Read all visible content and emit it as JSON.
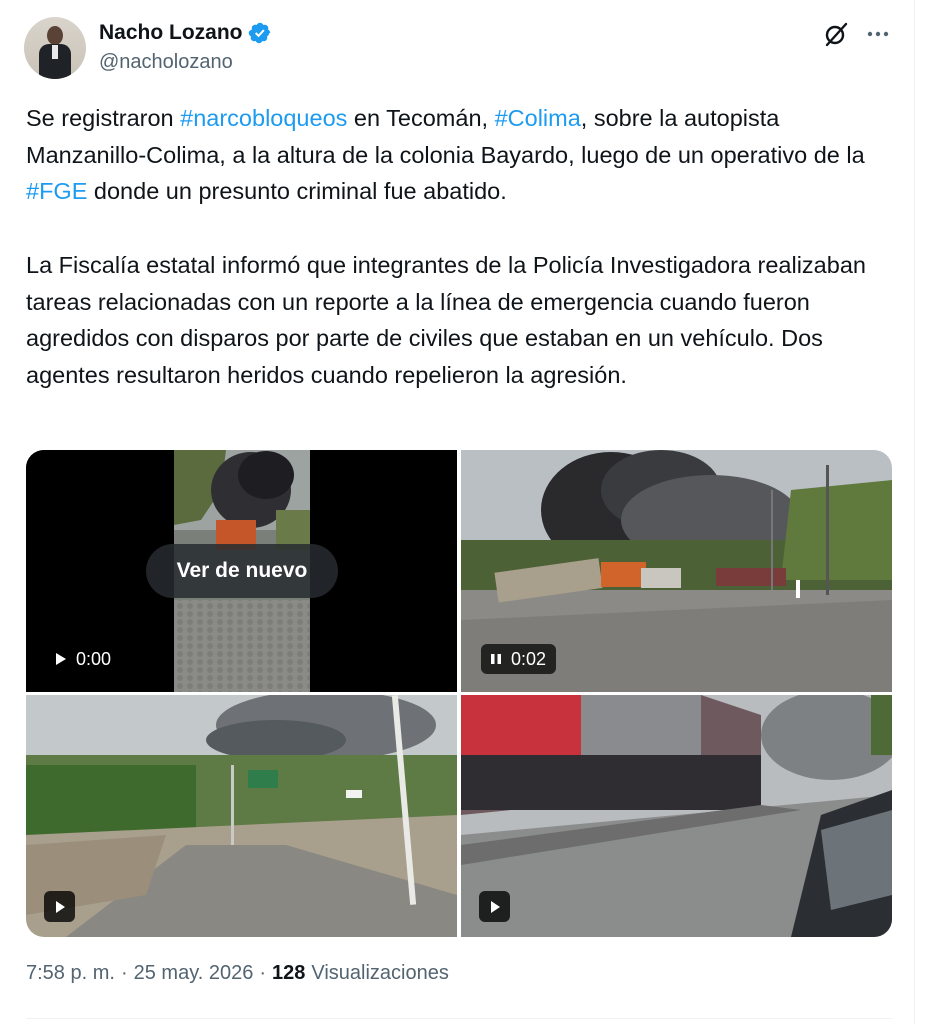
{
  "author": {
    "name": "Nacho Lozano",
    "handle": "@nacholozano",
    "verified": true,
    "avatar_icon": "profile-photo-man-in-suit"
  },
  "header_actions": {
    "grok_icon": "grok-icon",
    "more_icon": "more-icon"
  },
  "tweet": {
    "p1_a": "Se registraron ",
    "p1_tag1": "#narcobloqueos",
    "p1_b": " en Tecomán, ",
    "p1_tag2": "#Colima",
    "p1_c": ", sobre la autopista Manzanillo-Colima, a la altura de la colonia Bayardo, luego de un operativo de la ",
    "p1_tag3": "#FGE",
    "p1_d": " donde un presunto criminal fue abatido.",
    "p2": "La Fiscalía estatal informó que integrantes de la Policía Investigadora realizaban tareas relacionadas con un reporte a la línea de emergencia cuando fueron agredidos con disparos por parte de civiles que estaban en un vehículo. Dos agentes resultaron heridos cuando repelieron la agresión."
  },
  "media": [
    {
      "kind": "video",
      "replay_label": "Ver de nuevo",
      "time": "0:00",
      "control_icon": "play-icon"
    },
    {
      "kind": "video",
      "time": "0:02",
      "control_icon": "pause-icon"
    },
    {
      "kind": "video",
      "control_icon": "play-icon"
    },
    {
      "kind": "video",
      "control_icon": "play-icon"
    }
  ],
  "footer": {
    "time": "7:58 p. m.",
    "sep1": "·",
    "date": "25 may. 2026",
    "sep2": "·",
    "views_count": "128",
    "views_label": "Visualizaciones"
  },
  "colors": {
    "link": "#1d9bf0",
    "text": "#0f1419",
    "secondary": "#536471",
    "verified_badge": "#1d9bf0"
  }
}
